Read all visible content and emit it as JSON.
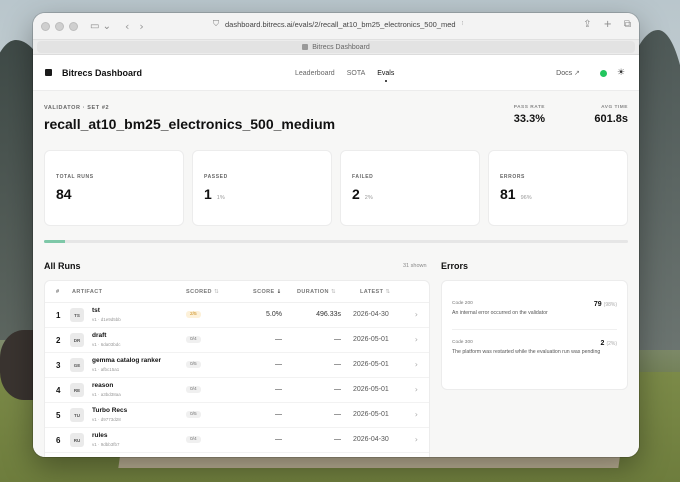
{
  "browser": {
    "url": "dashboard.bitrecs.ai/evals/2/recall_at10_bm25_electronics_500_med",
    "tab_title": "Bitrecs Dashboard"
  },
  "topnav": {
    "brand": "Bitrecs Dashboard",
    "links": [
      "Leaderboard",
      "SOTA",
      "Evals"
    ],
    "active_link": "Evals",
    "docs": "Docs",
    "status_color": "#22c55e"
  },
  "header": {
    "eyebrow": "VALIDATOR · SET #2",
    "title": "recall_at10_bm25_electronics_500_medium",
    "pass_rate_label": "PASS RATE",
    "pass_rate": "33.3%",
    "avg_time_label": "AVG TIME",
    "avg_time": "601.8s"
  },
  "cards": [
    {
      "label": "TOTAL RUNS",
      "value": "84",
      "pct": ""
    },
    {
      "label": "PASSED",
      "value": "1",
      "pct": "1%"
    },
    {
      "label": "FAILED",
      "value": "2",
      "pct": "2%"
    },
    {
      "label": "ERRORS",
      "value": "81",
      "pct": "96%"
    }
  ],
  "progress": {
    "passed_fraction": 0.012,
    "failed_fraction": 0.024
  },
  "runs": {
    "title": "All Runs",
    "count": "31 shown",
    "columns": {
      "num": "#",
      "artifact": "ARTIFACT",
      "scored": "SCORED",
      "score": "SCORE",
      "duration": "DURATION",
      "latest": "LATEST"
    },
    "rows": [
      {
        "num": "1",
        "initials": "TS",
        "name": "tst",
        "sub": "v1 · d1e9d5bb",
        "scored": "2/5",
        "score": "5.0%",
        "duration": "496.33s",
        "latest": "2026-04-30"
      },
      {
        "num": "2",
        "initials": "DR",
        "name": "draft",
        "sub": "v1 · 6da03bdc",
        "scored": "0/4",
        "score": "—",
        "duration": "—",
        "latest": "2026-05-01"
      },
      {
        "num": "3",
        "initials": "GE",
        "name": "gemma catalog ranker",
        "sub": "v1 · afbc15a1",
        "scored": "0/5",
        "score": "—",
        "duration": "—",
        "latest": "2026-05-01"
      },
      {
        "num": "4",
        "initials": "RE",
        "name": "reason",
        "sub": "v1 · a3bd38aa",
        "scored": "0/4",
        "score": "—",
        "duration": "—",
        "latest": "2026-05-01"
      },
      {
        "num": "5",
        "initials": "TU",
        "name": "Turbo Recs",
        "sub": "v1 · d9773d28",
        "scored": "0/5",
        "score": "—",
        "duration": "—",
        "latest": "2026-05-01"
      },
      {
        "num": "6",
        "initials": "RU",
        "name": "rules",
        "sub": "v1 · 9dbb3fb7",
        "scored": "0/4",
        "score": "—",
        "duration": "—",
        "latest": "2026-04-30"
      }
    ]
  },
  "errors": {
    "title": "Errors",
    "items": [
      {
        "code": "Code 200",
        "count": "79",
        "pct": "(98%)",
        "message": "An internal error occurred on the validator"
      },
      {
        "code": "Code 300",
        "count": "2",
        "pct": "(2%)",
        "message": "The platform was restarted while the evaluation run was pending"
      }
    ]
  }
}
